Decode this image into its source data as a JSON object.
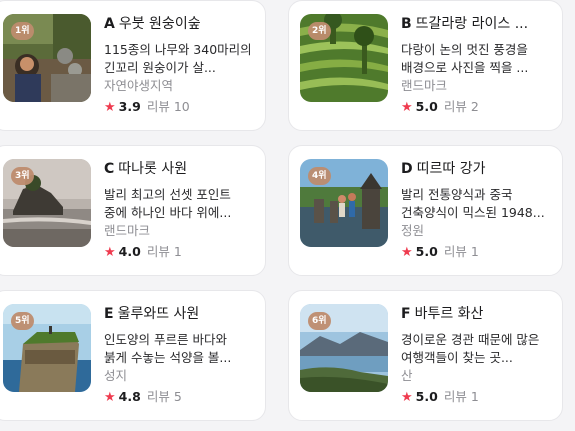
{
  "places": [
    {
      "rank": "1위",
      "letter": "A",
      "name": "우붓 원숭이숲",
      "description": "115종의 나무와 340마리의 긴꼬리 원숭이가 살...",
      "category": "자연야생지역",
      "rating": "3.9",
      "review_label": "리뷰",
      "review_count": "10",
      "image": "monkey-forest"
    },
    {
      "rank": "2위",
      "letter": "B",
      "name": "뜨갈라랑 라이스 ...",
      "description": "다랑이 논의 멋진 풍경을 배경으로 사진을 찍을 ...",
      "category": "랜드마크",
      "rating": "5.0",
      "review_label": "리뷰",
      "review_count": "2",
      "image": "rice-terrace"
    },
    {
      "rank": "3위",
      "letter": "C",
      "name": "따나롯 사원",
      "description": "발리 최고의 선셋 포인트 중에 하나인 바다 위에...",
      "category": "랜드마크",
      "rating": "4.0",
      "review_label": "리뷰",
      "review_count": "1",
      "image": "sea-temple"
    },
    {
      "rank": "4위",
      "letter": "D",
      "name": "띠르따 강가",
      "description": "발리 전통양식과 중국 건축양식이 믹스된 1948...",
      "category": "정원",
      "rating": "5.0",
      "review_label": "리뷰",
      "review_count": "1",
      "image": "water-palace"
    },
    {
      "rank": "5위",
      "letter": "E",
      "name": "울루와뜨 사원",
      "description": "인도양의 푸르른 바다와 붉게 수놓는 석양을 볼...",
      "category": "성지",
      "rating": "4.8",
      "review_label": "리뷰",
      "review_count": "5",
      "image": "cliff-temple"
    },
    {
      "rank": "6위",
      "letter": "F",
      "name": "바투르 화산",
      "description": "경이로운 경관 때문에 많은 여행객들이 찾는 곳...",
      "category": "산",
      "rating": "5.0",
      "review_label": "리뷰",
      "review_count": "1",
      "image": "volcano"
    }
  ],
  "colors": {
    "star": "#ef3b4f",
    "rank_badge": "#be8c6e",
    "card_border": "#e7e7ea"
  },
  "icons": {
    "star": "star-icon"
  }
}
